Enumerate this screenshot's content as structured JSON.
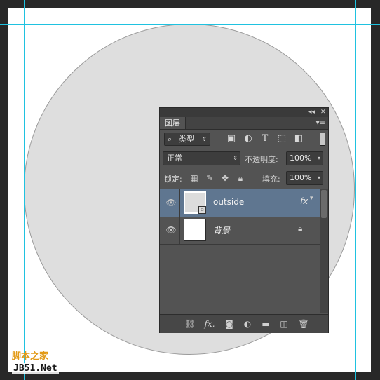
{
  "panel": {
    "tab_label": "图层",
    "collapse_icon": "◂◂",
    "close_icon": "✕",
    "menu_icon": "≡",
    "filter": {
      "search_icon": "⌕",
      "kind_label": "类型",
      "icons": [
        "image-filter-icon",
        "adjustment-filter-icon",
        "type-filter-icon",
        "shape-filter-icon",
        "smart-object-filter-icon"
      ]
    },
    "blend_mode": "正常",
    "opacity_label": "不透明度:",
    "opacity_value": "100%",
    "lock_label": "锁定:",
    "fill_label": "填充:",
    "fill_value": "100%",
    "layers": [
      {
        "name": "outside",
        "selected": true,
        "has_fx": true,
        "fx_label": "fx",
        "smart_object": true
      },
      {
        "name": "背景",
        "selected": false,
        "locked": true,
        "italic": true
      }
    ],
    "bottom_icons": [
      "link-layers-icon",
      "add-style-icon",
      "add-mask-icon",
      "new-adjustment-icon",
      "new-group-icon",
      "new-layer-icon",
      "delete-layer-icon"
    ],
    "bottom_fx_label": "fx."
  },
  "watermark": {
    "line1": "脚本之家",
    "line2": "JB51.Net"
  },
  "colors": {
    "selected_row": "#5f7690",
    "guide": "#1fc2e0",
    "circle_fill": "#dedede"
  }
}
